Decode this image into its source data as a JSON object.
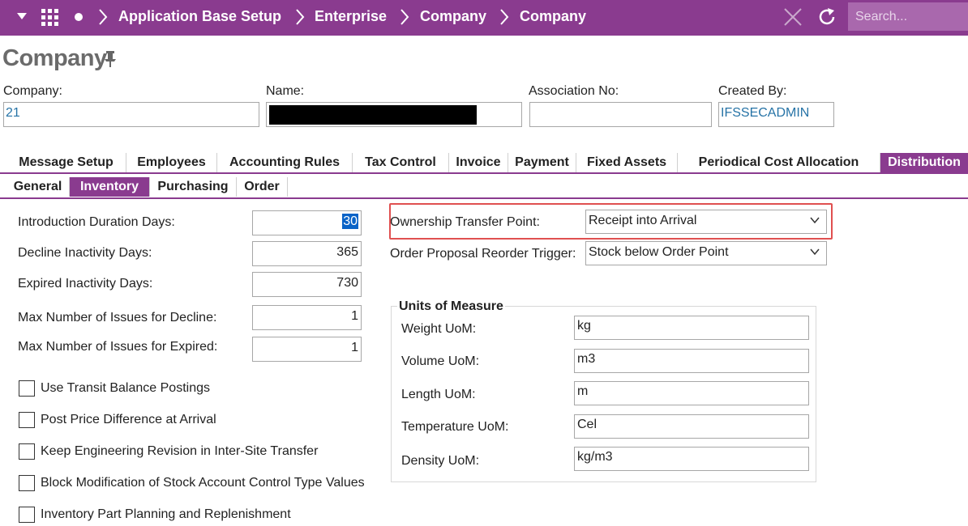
{
  "breadcrumb": {
    "items": [
      "Application Base Setup",
      "Enterprise",
      "Company",
      "Company"
    ],
    "search_placeholder": "Search..."
  },
  "page": {
    "title": "Company"
  },
  "header_fields": {
    "company_label": "Company:",
    "company_value": "21",
    "name_label": "Name:",
    "association_label": "Association No:",
    "association_value": "",
    "created_by_label": "Created By:",
    "created_by_value": "IFSSECADMIN"
  },
  "tabs": [
    "Message Setup",
    "Employees",
    "Accounting Rules",
    "Tax Control",
    "Invoice",
    "Payment",
    "Fixed Assets",
    "Periodical Cost Allocation",
    "Distribution"
  ],
  "subtabs": [
    "General",
    "Inventory",
    "Purchasing",
    "Order"
  ],
  "fields": {
    "intro_label": "Introduction Duration Days:",
    "intro_value": "30",
    "decline_label": "Decline Inactivity Days:",
    "decline_value": "365",
    "expired_label": "Expired Inactivity Days:",
    "expired_value": "730",
    "max_decline_label": "Max Number of Issues for Decline:",
    "max_decline_value": "1",
    "max_expired_label": "Max Number of Issues for Expired:",
    "max_expired_value": "1"
  },
  "checkboxes": [
    "Use Transit Balance Postings",
    "Post Price Difference at Arrival",
    "Keep Engineering Revision in Inter-Site Transfer",
    "Block Modification of Stock Account Control Type Values",
    "Inventory Part Planning and Replenishment"
  ],
  "dropdowns": {
    "ownership_label": "Ownership Transfer Point:",
    "ownership_value": "Receipt into Arrival",
    "reorder_label": "Order Proposal Reorder Trigger:",
    "reorder_value": "Stock below Order Point"
  },
  "uom": {
    "title": "Units of Measure",
    "weight_label": "Weight UoM:",
    "weight_value": "kg",
    "volume_label": "Volume UoM:",
    "volume_value": "m3",
    "length_label": "Length UoM:",
    "length_value": "m",
    "temperature_label": "Temperature UoM:",
    "temperature_value": "Cel",
    "density_label": "Density UoM:",
    "density_value": "kg/m3"
  },
  "colors": {
    "accent": "#8a3b8f",
    "highlight": "#e05050",
    "link_text": "#2673a6"
  }
}
